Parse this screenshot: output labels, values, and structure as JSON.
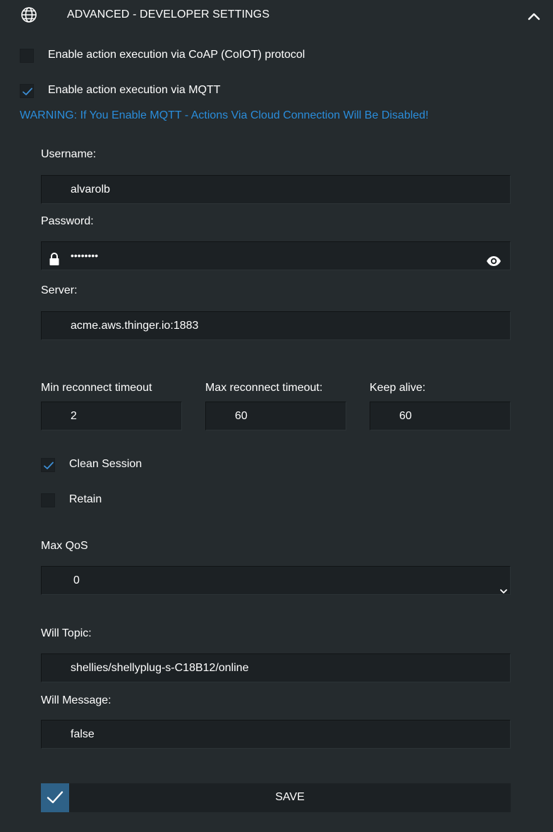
{
  "header": {
    "title": "ADVANCED - DEVELOPER SETTINGS",
    "globe_icon": "globe-icon",
    "collapse_icon": "chevron-up-icon"
  },
  "options": {
    "coap_label": "Enable action execution via CoAP (CoIOT) protocol",
    "coap_checked": false,
    "mqtt_label": "Enable action execution via MQTT",
    "mqtt_checked": true,
    "warning": "WARNING: If You Enable MQTT - Actions Via Cloud Connection Will Be Disabled!"
  },
  "mqtt": {
    "username_label": "Username:",
    "username_value": "alvarolb",
    "password_label": "Password:",
    "password_value": "••••••••",
    "server_label": "Server:",
    "server_value": "acme.aws.thinger.io:1883",
    "min_reconnect_label": "Min reconnect timeout",
    "min_reconnect_value": "2",
    "max_reconnect_label": "Max reconnect timeout:",
    "max_reconnect_value": "60",
    "keep_alive_label": "Keep alive:",
    "keep_alive_value": "60",
    "clean_session_label": "Clean Session",
    "clean_session_checked": true,
    "retain_label": "Retain",
    "retain_checked": false,
    "max_qos_label": "Max QoS",
    "max_qos_value": "0",
    "will_topic_label": "Will Topic:",
    "will_topic_value": "shellies/shellyplug-s-C18B12/online",
    "will_message_label": "Will Message:",
    "will_message_value": "false"
  },
  "footer": {
    "save_label": "SAVE"
  },
  "colors": {
    "background": "#252b2e",
    "input_bg": "#1c2124",
    "warning": "#2a8ddb",
    "checkmark": "#3d8fd6",
    "save_accent": "#2e6187"
  }
}
